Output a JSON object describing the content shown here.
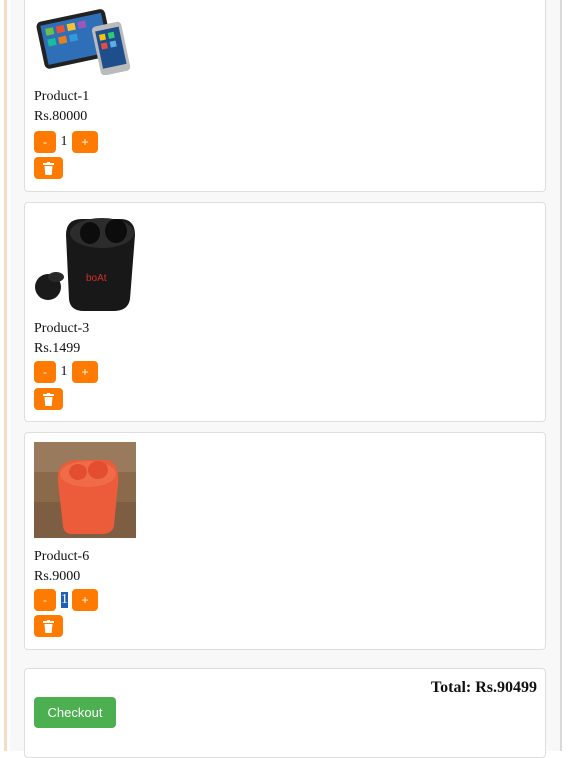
{
  "cart": {
    "items": [
      {
        "name": "Product-1",
        "price": "Rs.80000",
        "qty": "1",
        "minus": "-",
        "plus": "+",
        "image": "tablet-phone-image"
      },
      {
        "name": "Product-3",
        "price": "Rs.1499",
        "qty": "1",
        "minus": "-",
        "plus": "+",
        "image": "black-earbuds-case-image",
        "brand_text": "boAt"
      },
      {
        "name": "Product-6",
        "price": "Rs.9000",
        "qty": "1",
        "minus": "-",
        "plus": "+",
        "image": "orange-earbuds-case-image"
      }
    ],
    "total": "Total: Rs.90499",
    "checkout_label": "Checkout",
    "delete_icon": "trash-icon"
  },
  "colors": {
    "accent": "#ff7a00",
    "checkout": "#4caf50",
    "selection": "#1f5fb8"
  }
}
